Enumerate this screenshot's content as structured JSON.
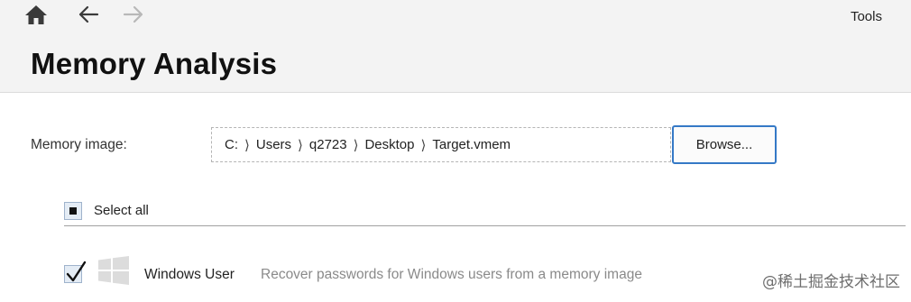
{
  "header": {
    "tools_label": "Tools",
    "title": "Memory Analysis",
    "nav": {
      "home_icon": "home-icon",
      "back_icon": "arrow-left-icon",
      "forward_icon": "arrow-right-icon",
      "forward_enabled": false
    }
  },
  "memory_image": {
    "label": "Memory image:",
    "path_segments": [
      "C:",
      "Users",
      "q2723",
      "Desktop",
      "Target.vmem"
    ],
    "path_separator": "⟩",
    "browse_label": "Browse..."
  },
  "select_all": {
    "label": "Select all",
    "state": "indeterminate"
  },
  "items": [
    {
      "name": "Windows User",
      "description": "Recover passwords for Windows users from a memory image",
      "checked": true,
      "icon": "windows-logo-icon"
    }
  ],
  "watermark": "@稀土掘金技术社区",
  "colors": {
    "header_bg": "#f3f3f3",
    "accent": "#3579c6",
    "checkbox_bg": "#e4ecf5",
    "muted_text": "#8a8a8a",
    "disabled_icon": "#b8b8b8"
  }
}
